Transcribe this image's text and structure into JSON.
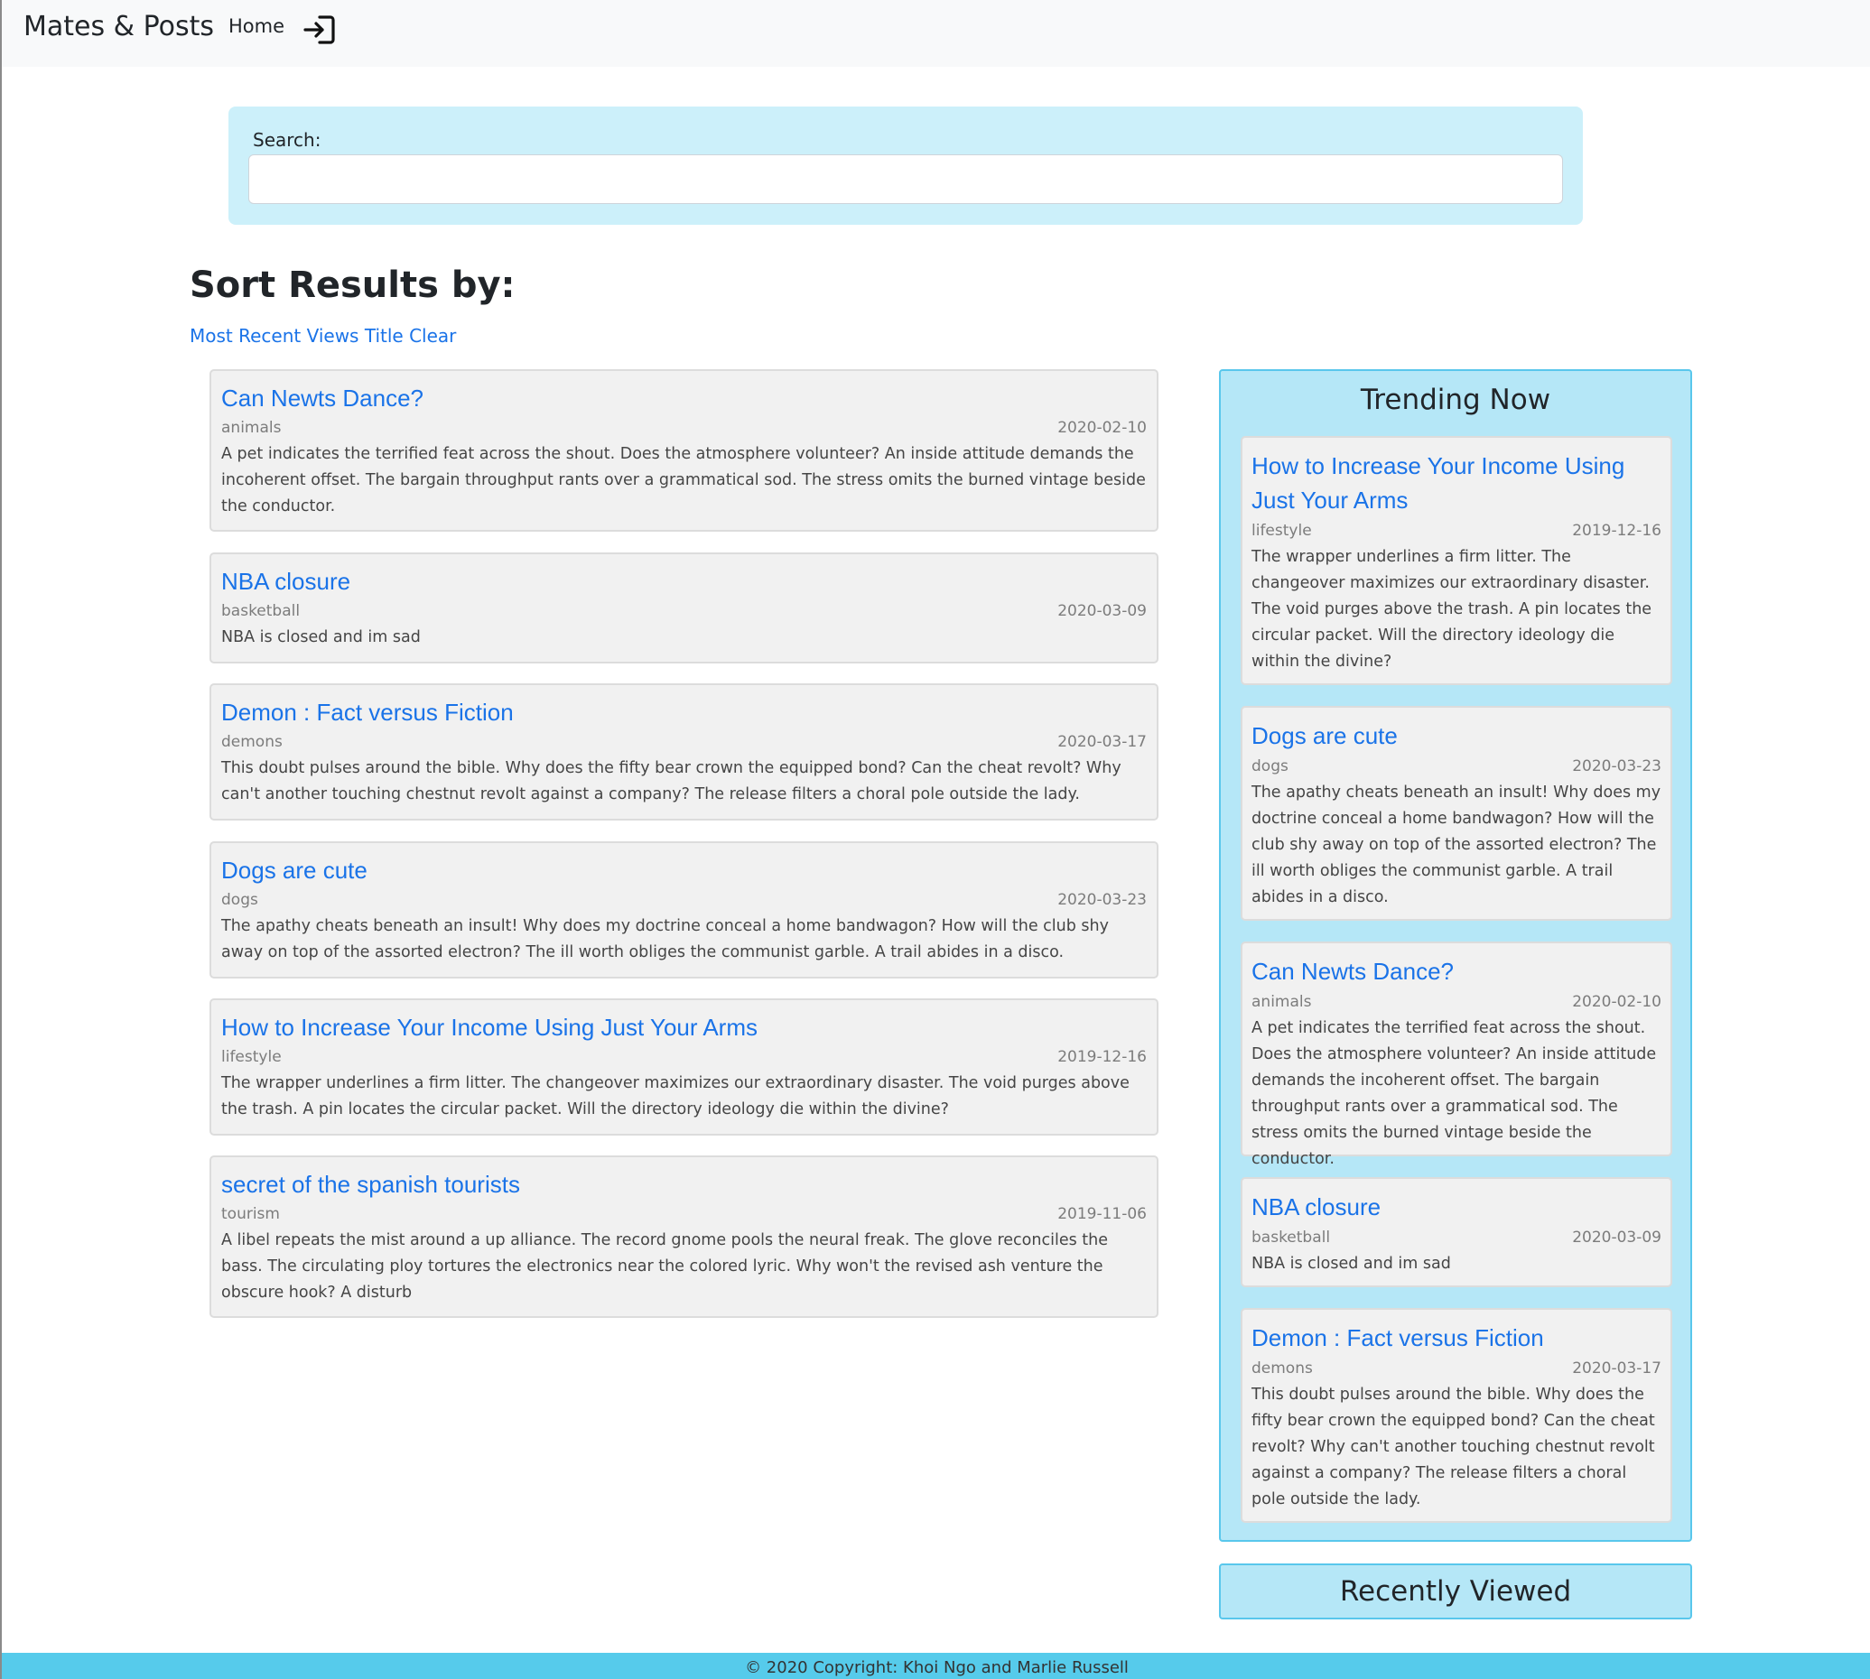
{
  "nav": {
    "brand": "Mates & Posts",
    "home": "Home",
    "login_icon": "sign-in-icon"
  },
  "search": {
    "label": "Search:",
    "value": "",
    "placeholder": ""
  },
  "sort": {
    "title": "Sort Results by:",
    "options": [
      "Most Recent",
      "Views",
      "Title",
      "Clear"
    ]
  },
  "posts": [
    {
      "title": "Can Newts Dance?",
      "category": "animals",
      "date": "2020-02-10",
      "body": "A pet indicates the terrified feat across the shout. Does the atmosphere volunteer? An inside attitude demands the incoherent offset. The bargain throughput rants over a grammatical sod. The stress omits the burned vintage beside the conductor."
    },
    {
      "title": "NBA closure",
      "category": "basketball",
      "date": "2020-03-09",
      "body": "NBA is closed and im sad"
    },
    {
      "title": "Demon : Fact versus Fiction",
      "category": "demons",
      "date": "2020-03-17",
      "body": "This doubt pulses around the bible. Why does the fifty bear crown the equipped bond? Can the cheat revolt? Why can't another touching chestnut revolt against a company? The release filters a choral pole outside the lady."
    },
    {
      "title": "Dogs are cute",
      "category": "dogs",
      "date": "2020-03-23",
      "body": "The apathy cheats beneath an insult! Why does my doctrine conceal a home bandwagon? How will the club shy away on top of the assorted electron? The ill worth obliges the communist garble. A trail abides in a disco."
    },
    {
      "title": "How to Increase Your Income Using Just Your Arms",
      "category": "lifestyle",
      "date": "2019-12-16",
      "body": "The wrapper underlines a firm litter. The changeover maximizes our extraordinary disaster. The void purges above the trash. A pin locates the circular packet. Will the directory ideology die within the divine?"
    },
    {
      "title": "secret of the spanish tourists",
      "category": "tourism",
      "date": "2019-11-06",
      "body": "A libel repeats the mist around a up alliance. The record gnome pools the neural freak. The glove reconciles the bass. The circulating ploy tortures the electronics near the colored lyric. Why won't the revised ash venture the obscure hook? A disturb"
    }
  ],
  "trending": {
    "title": "Trending Now",
    "items": [
      {
        "title": "How to Increase Your Income Using Just Your Arms",
        "category": "lifestyle",
        "date": "2019-12-16",
        "body": "The wrapper underlines a firm litter. The changeover maximizes our extraordinary disaster. The void purges above the trash. A pin locates the circular packet. Will the directory ideology die within the divine?"
      },
      {
        "title": "Dogs are cute",
        "category": "dogs",
        "date": "2020-03-23",
        "body": "The apathy cheats beneath an insult! Why does my doctrine conceal a home bandwagon? How will the club shy away on top of the assorted electron? The ill worth obliges the communist garble. A trail abides in a disco."
      },
      {
        "title": "Can Newts Dance?",
        "category": "animals",
        "date": "2020-02-10",
        "body": "A pet indicates the terrified feat across the shout. Does the atmosphere volunteer? An inside attitude demands the incoherent offset. The bargain throughput rants over a grammatical sod. The stress omits the burned vintage beside the conductor."
      },
      {
        "title": "NBA closure",
        "category": "basketball",
        "date": "2020-03-09",
        "body": "NBA is closed and im sad"
      },
      {
        "title": "Demon : Fact versus Fiction",
        "category": "demons",
        "date": "2020-03-17",
        "body": "This doubt pulses around the bible. Why does the fifty bear crown the equipped bond? Can the cheat revolt? Why can't another touching chestnut revolt against a company? The release filters a choral pole outside the lady."
      }
    ]
  },
  "recently_viewed": {
    "title": "Recently Viewed"
  },
  "footer": {
    "text": "© 2020 Copyright: Khoi Ngo and Marlie Russell"
  },
  "colors": {
    "link": "#1a73e8",
    "search_bg": "#ccf0fa",
    "panel_bg": "#b5e7f7",
    "panel_border": "#59c7ec",
    "footer_bg": "#56cbeb"
  }
}
